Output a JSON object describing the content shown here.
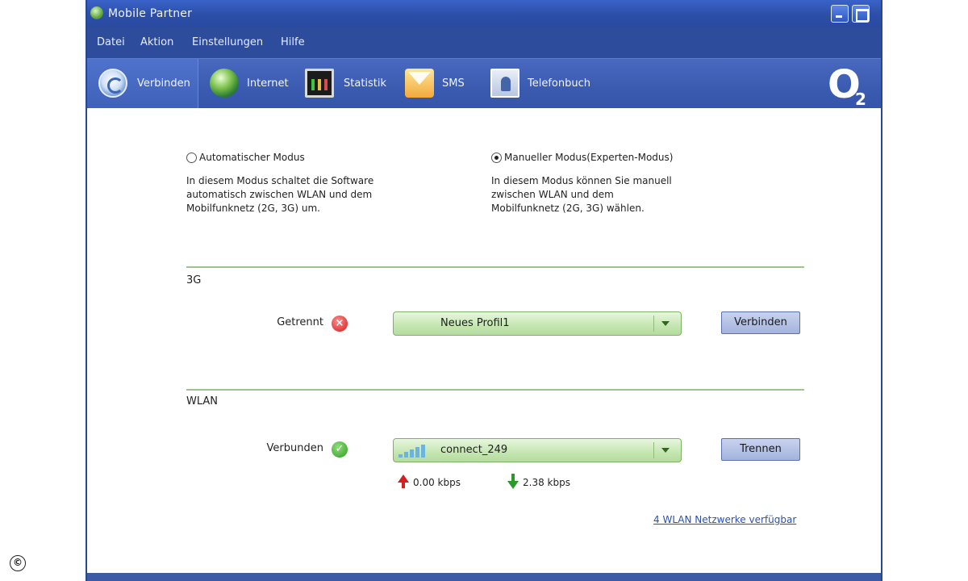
{
  "window": {
    "title": "Mobile Partner"
  },
  "menu": [
    {
      "label": "Datei"
    },
    {
      "label": "Aktion"
    },
    {
      "label": "Einstellungen"
    },
    {
      "label": "Hilfe"
    }
  ],
  "toolbar": [
    {
      "label": "Verbinden",
      "icon": "connect-icon",
      "active": true
    },
    {
      "label": "Internet",
      "icon": "globe-icon"
    },
    {
      "label": "Statistik",
      "icon": "statistics-icon"
    },
    {
      "label": "SMS",
      "icon": "sms-envelope-icon"
    },
    {
      "label": "Telefonbuch",
      "icon": "phonebook-icon"
    }
  ],
  "brand": {
    "logo": "O",
    "subscript": "2"
  },
  "modes": {
    "automatic": {
      "label": "Automatischer Modus",
      "selected": false,
      "description": "In diesem Modus schaltet die Software automatisch zwischen WLAN und dem Mobilfunknetz (2G, 3G) um."
    },
    "manual": {
      "label": "Manueller Modus(Experten-Modus)",
      "selected": true,
      "description": "In diesem Modus können Sie manuell zwischen WLAN und dem Mobilfunknetz (2G, 3G) wählen."
    }
  },
  "section_3g": {
    "title": "3G",
    "status": "Getrennt",
    "status_icon": "error-icon",
    "profile": "Neues Profil1",
    "button": "Verbinden"
  },
  "section_wlan": {
    "title": "WLAN",
    "status": "Verbunden",
    "status_icon": "success-icon",
    "network": "connect_249",
    "button": "Trennen",
    "upload": "0.00 kbps",
    "download": "2.38 kbps",
    "networks_link": "4 WLAN Netzwerke verfügbar"
  },
  "colors": {
    "accent_blue": "#2f4fa3",
    "dropdown_green": "#c4e6b0",
    "divider_green": "#9cc48c",
    "error_red": "#d51a1a",
    "ok_green": "#2f9a22"
  }
}
